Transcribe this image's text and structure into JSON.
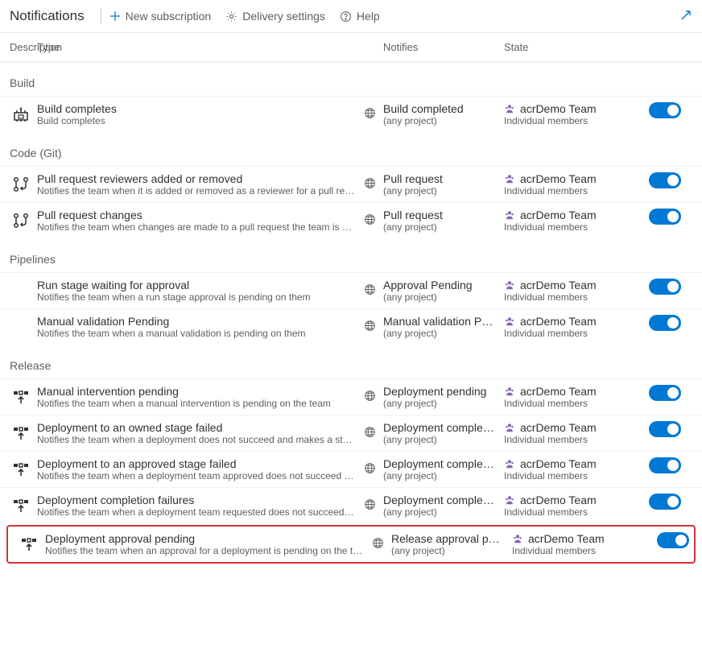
{
  "toolbar": {
    "title": "Notifications",
    "new_subscription": "New subscription",
    "delivery_settings": "Delivery settings",
    "help": "Help"
  },
  "headers": {
    "description": "Description",
    "type": "Type",
    "notifies": "Notifies",
    "state": "State"
  },
  "common": {
    "any_project": "(any project)",
    "individual_members": "Individual members",
    "team_name": "acrDemo Team"
  },
  "sections": [
    {
      "name": "Build",
      "rows": [
        {
          "icon": "build",
          "title": "Build completes",
          "sub": "Build completes",
          "type": "Build completed",
          "highlight": false
        }
      ]
    },
    {
      "name": "Code (Git)",
      "rows": [
        {
          "icon": "pullrequest",
          "title": "Pull request reviewers added or removed",
          "sub": "Notifies the team when it is added or removed as a reviewer for a pull requ…",
          "type": "Pull request",
          "highlight": false
        },
        {
          "icon": "pullrequest",
          "title": "Pull request changes",
          "sub": "Notifies the team when changes are made to a pull request the team is a r…",
          "type": "Pull request",
          "highlight": false
        }
      ]
    },
    {
      "name": "Pipelines",
      "rows": [
        {
          "icon": "",
          "title": "Run stage waiting for approval",
          "sub": "Notifies the team when a run stage approval is pending on them",
          "type": "Approval Pending",
          "highlight": false
        },
        {
          "icon": "",
          "title": "Manual validation Pending",
          "sub": "Notifies the team when a manual validation is pending on them",
          "type": "Manual validation Pe…",
          "highlight": false
        }
      ]
    },
    {
      "name": "Release",
      "rows": [
        {
          "icon": "release",
          "title": "Manual intervention pending",
          "sub": "Notifies the team when a manual intervention is pending on the team",
          "type": "Deployment pending",
          "highlight": false
        },
        {
          "icon": "release",
          "title": "Deployment to an owned stage failed",
          "sub": "Notifies the team when a deployment does not succeed and makes a stag…",
          "type": "Deployment comple…",
          "highlight": false
        },
        {
          "icon": "release",
          "title": "Deployment to an approved stage failed",
          "sub": "Notifies the team when a deployment team approved does not succeed an…",
          "type": "Deployment comple…",
          "highlight": false
        },
        {
          "icon": "release",
          "title": "Deployment completion failures",
          "sub": "Notifies the team when a deployment team requested does not succeed a…",
          "type": "Deployment comple…",
          "highlight": false
        },
        {
          "icon": "release",
          "title": "Deployment approval pending",
          "sub": "Notifies the team when an approval for a deployment is pending on the te…",
          "type": "Release approval pe…",
          "highlight": true
        }
      ]
    }
  ]
}
